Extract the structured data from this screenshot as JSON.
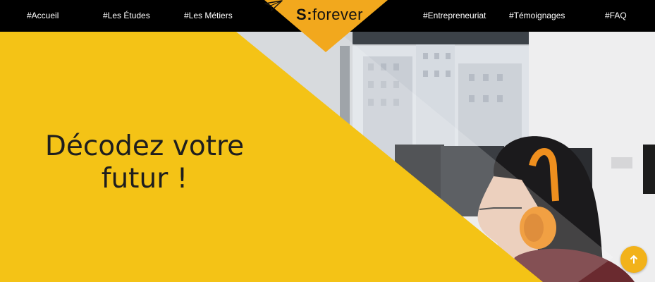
{
  "nav": {
    "links": [
      "#Accueil",
      "#Les Études",
      "#Les Métiers",
      "#Entrepreneuriat",
      "#Témoignages",
      "#FAQ"
    ]
  },
  "logo": {
    "letter": "S",
    "colon": ":",
    "word": "forever",
    "icon": "paper-plane-icon"
  },
  "hero": {
    "headline_line1": "Décodez votre",
    "headline_line2": "futur !"
  },
  "scroll_top": {
    "icon": "arrow-up-icon"
  },
  "colors": {
    "brand_yellow": "#f4c316",
    "badge_orange": "#f2a81d",
    "navbar_bg": "#000000",
    "nav_text": "#ffffff",
    "headline_text": "#1e1e1e"
  }
}
